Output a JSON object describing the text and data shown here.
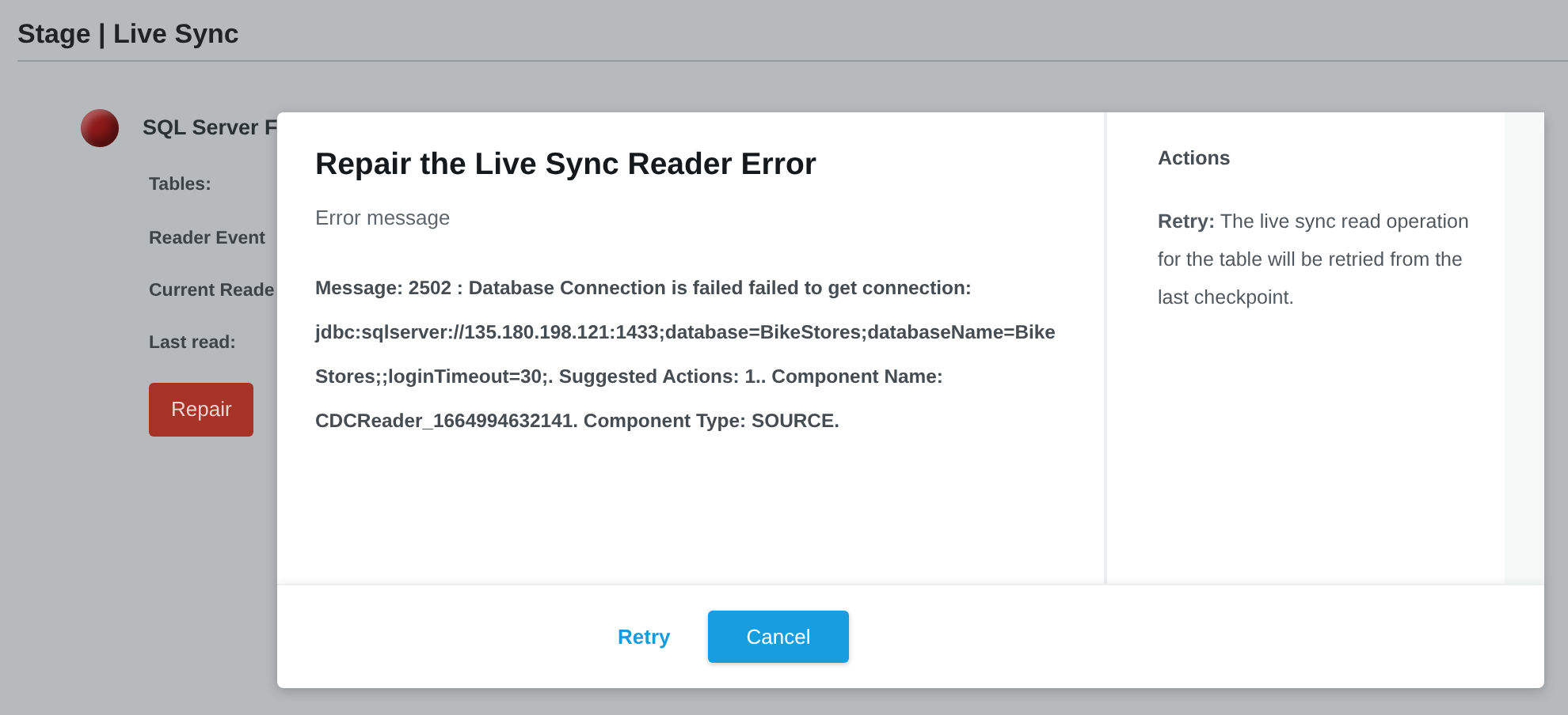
{
  "page": {
    "title": "Stage | Live Sync"
  },
  "source": {
    "name": "SQL Server F",
    "color": "#8e1a1a",
    "fields": [
      "Tables:",
      "Reader Event",
      "Current Reade",
      "Last read:"
    ],
    "button": "Repair"
  },
  "dialog": {
    "title": "Repair the Live Sync Reader Error",
    "subtitle": "Error message",
    "message": "Message: 2502 : Database Connection is failed failed to get connection: jdbc:sqlserver://135.180.198.121:1433;database=BikeStores;databaseName=BikeStores;;loginTimeout=30;. Suggested Actions: 1.. Component Name: CDCReader_1664994632141. Component Type: SOURCE.",
    "actions_title": "Actions",
    "actions_text": "**Retry:** The live sync read operation for the table will be retried from the last checkpoint.",
    "buttons": [
      {
        "label": "Retry",
        "kind": "link"
      },
      {
        "label": "Cancel",
        "kind": "primary"
      }
    ]
  }
}
